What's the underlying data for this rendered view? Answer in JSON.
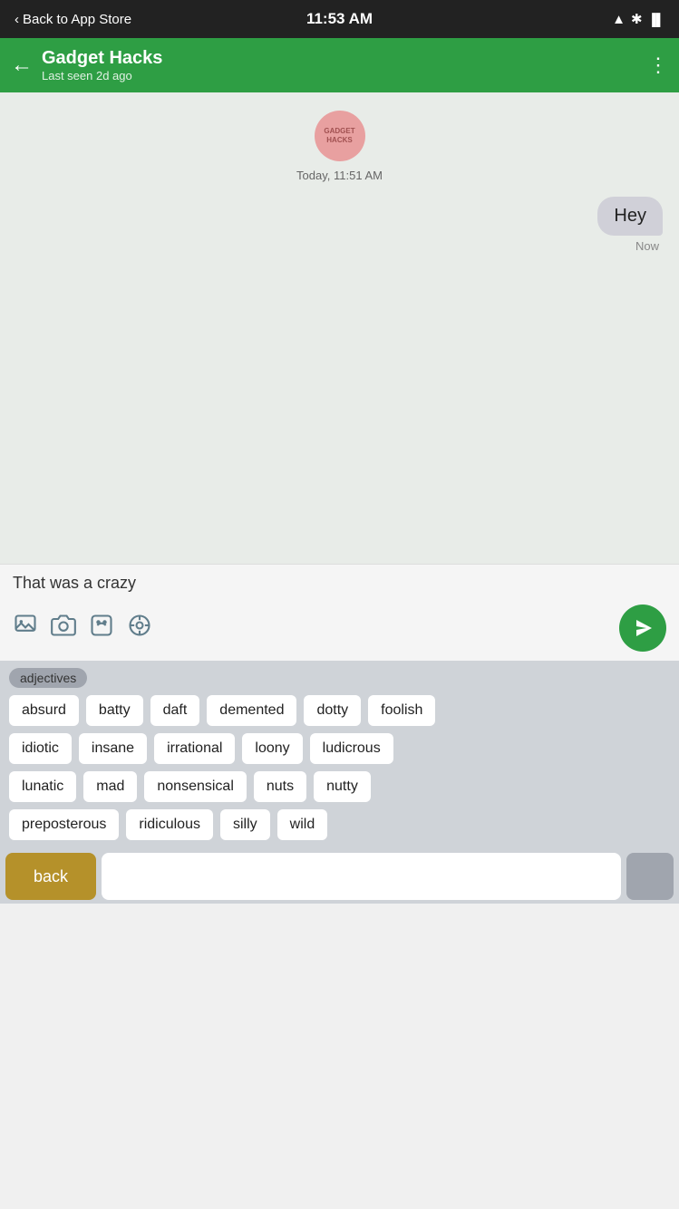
{
  "statusBar": {
    "backLabel": "Back to App Store",
    "time": "11:53 AM",
    "chevronLeft": "‹"
  },
  "header": {
    "contactName": "Gadget Hacks",
    "lastSeen": "Last seen 2d ago",
    "backArrow": "←",
    "moreMenu": "⋮"
  },
  "chat": {
    "avatarText": "GADGET\nHACKS",
    "timestamp": "Today, 11:51 AM",
    "messageBubble": "Hey",
    "messageTime": "Now"
  },
  "inputArea": {
    "text": "That was a crazy",
    "icons": {
      "gallery": "🖼",
      "camera": "📷",
      "sticker": "🎭",
      "location": "◎"
    },
    "sendIcon": "send"
  },
  "suggestions": {
    "categoryLabel": "adjectives",
    "words": [
      [
        "absurd",
        "batty",
        "daft",
        "demented",
        "dotty",
        "foolish"
      ],
      [
        "idiotic",
        "insane",
        "irrational",
        "loony",
        "ludicrous"
      ],
      [
        "lunatic",
        "mad",
        "nonsensical",
        "nuts",
        "nutty"
      ],
      [
        "preposterous",
        "ridiculous",
        "silly",
        "wild"
      ]
    ]
  },
  "keyboard": {
    "backLabel": "back"
  }
}
